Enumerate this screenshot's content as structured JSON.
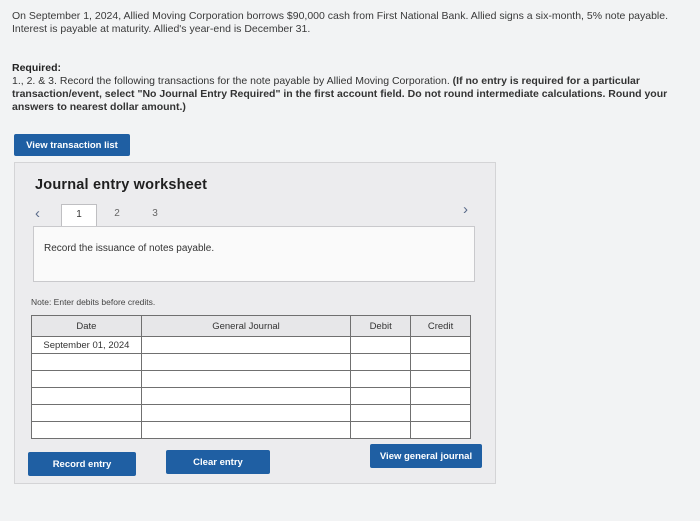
{
  "problem": {
    "text": "On September 1, 2024, Allied Moving Corporation borrows $90,000 cash from First National Bank. Allied signs a six-month, 5% note payable. Interest is payable at maturity. Allied's year-end is December 31."
  },
  "required": {
    "label": "Required:",
    "prefix": "1., 2. & 3. Record the following transactions for the note payable by Allied Moving Corporation.",
    "bold_instruction": "(If no entry is required for a particular transaction/event, select \"No Journal Entry Required\" in the first account field. Do not round intermediate calculations. Round your answers to nearest dollar amount.)"
  },
  "buttons": {
    "view_transaction_list": "View transaction list",
    "record_entry": "Record entry",
    "clear_entry": "Clear entry",
    "view_general_journal": "View general journal"
  },
  "worksheet": {
    "title": "Journal entry worksheet",
    "tabs": [
      "1",
      "2",
      "3"
    ],
    "active_tab": "1",
    "description": "Record the issuance of notes payable.",
    "note": "Note: Enter debits before credits.",
    "table": {
      "headers": {
        "date": "Date",
        "journal": "General Journal",
        "debit": "Debit",
        "credit": "Credit"
      },
      "first_date": "September 01, 2024"
    }
  },
  "icons": {
    "prev": "chevron-left-icon",
    "next": "chevron-right-icon"
  },
  "colors": {
    "accent": "#1f5fa3"
  }
}
